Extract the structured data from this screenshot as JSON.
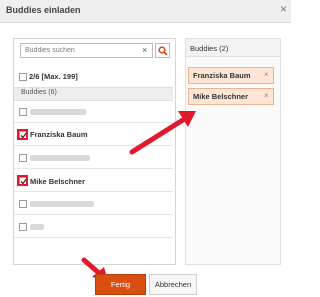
{
  "dialog": {
    "title": "Buddies einladen",
    "close_glyph": "×"
  },
  "search": {
    "placeholder": "Buddies suchen",
    "value": "",
    "clear_glyph": "×"
  },
  "selection": {
    "count_label": "2/6 [Max. 199]"
  },
  "buddies_section": {
    "label": "Buddies (6)"
  },
  "buddies": [
    {
      "name": "",
      "checked": false,
      "blurred": true
    },
    {
      "name": "Franziska Baum",
      "checked": true,
      "blurred": false
    },
    {
      "name": "",
      "checked": false,
      "blurred": true
    },
    {
      "name": "Mike Belschner",
      "checked": true,
      "blurred": false
    },
    {
      "name": "",
      "checked": false,
      "blurred": true
    },
    {
      "name": "",
      "checked": false,
      "blurred": true
    }
  ],
  "selected_panel": {
    "title": "Buddies (2)",
    "chips": [
      {
        "label": "Franziska Baum",
        "remove_glyph": "×"
      },
      {
        "label": "Mike Belschner",
        "remove_glyph": "×"
      }
    ]
  },
  "footer": {
    "done_label": "Fertig",
    "cancel_label": "Abbrechen"
  },
  "colors": {
    "accent": "#d94f12",
    "highlight_red": "#e0192d",
    "chip_bg": "#fde6d6"
  },
  "icons": {
    "search": "search-icon",
    "close": "close-icon",
    "check": "check-icon",
    "arrow": "red-arrow"
  }
}
